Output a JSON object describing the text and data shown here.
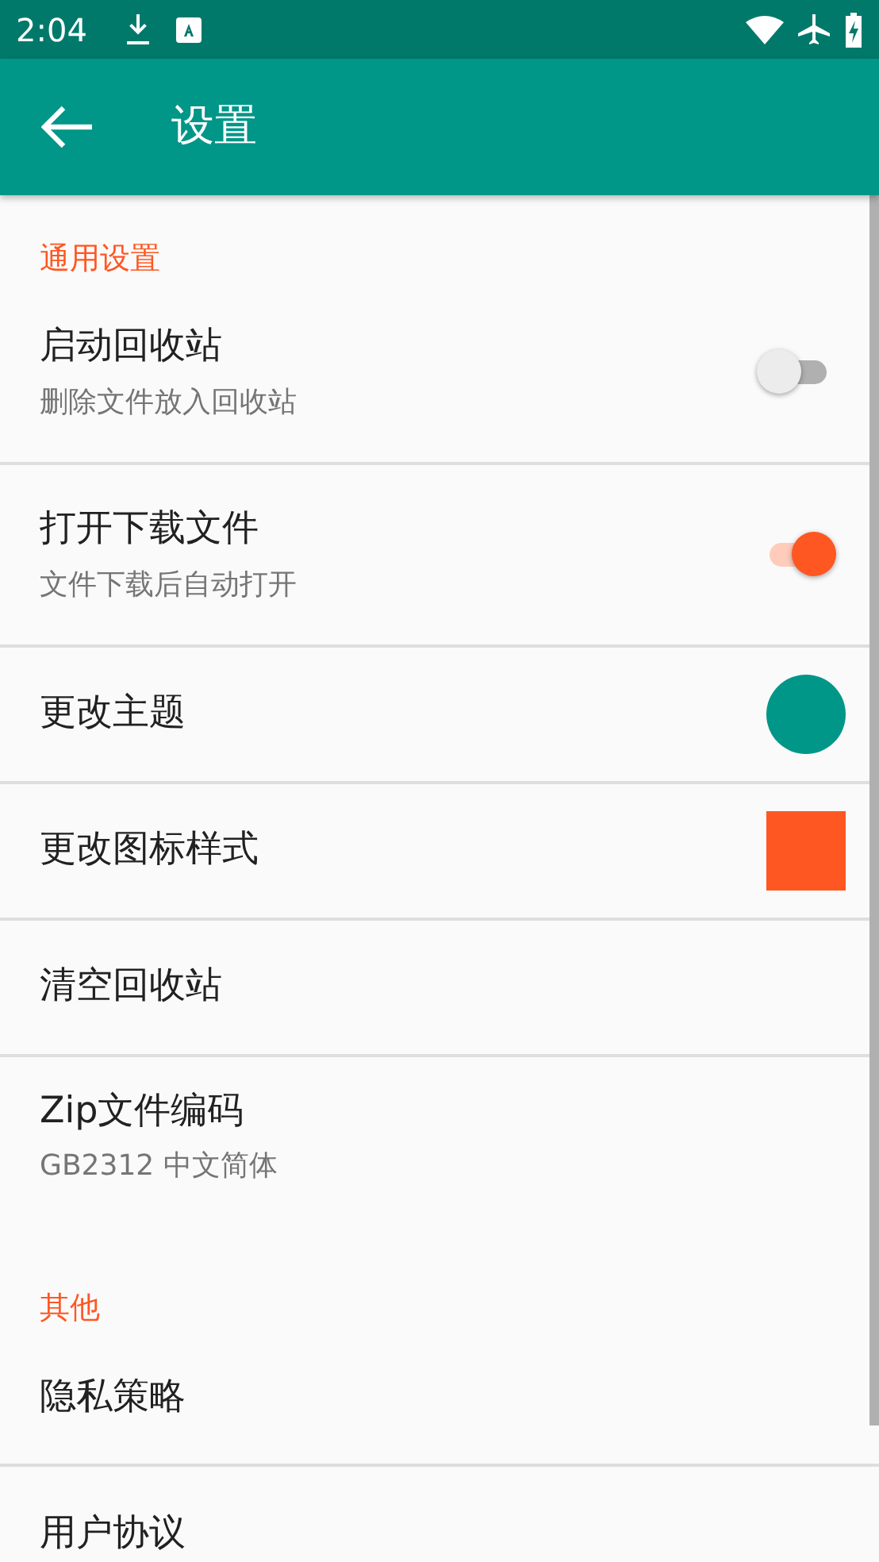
{
  "status_bar": {
    "time": "2:04"
  },
  "toolbar": {
    "title": "设置"
  },
  "sections": [
    {
      "title": "通用设置",
      "items": [
        {
          "kind": "switch",
          "title": "启动回收站",
          "subtitle": "删除文件放入回收站",
          "on": false
        },
        {
          "kind": "switch",
          "title": "打开下载文件",
          "subtitle": "文件下载后自动打开",
          "on": true
        },
        {
          "kind": "circle",
          "title": "更改主题",
          "color": "#009688"
        },
        {
          "kind": "square",
          "title": "更改图标样式",
          "color": "#ff5722"
        },
        {
          "kind": "plain",
          "title": "清空回收站"
        },
        {
          "kind": "plain",
          "title": "Zip文件编码",
          "subtitle": "GB2312 中文简体"
        }
      ]
    },
    {
      "title": "其他",
      "items": [
        {
          "kind": "plain",
          "title": "隐私策略"
        },
        {
          "kind": "plain",
          "title": "用户协议"
        }
      ]
    }
  ]
}
